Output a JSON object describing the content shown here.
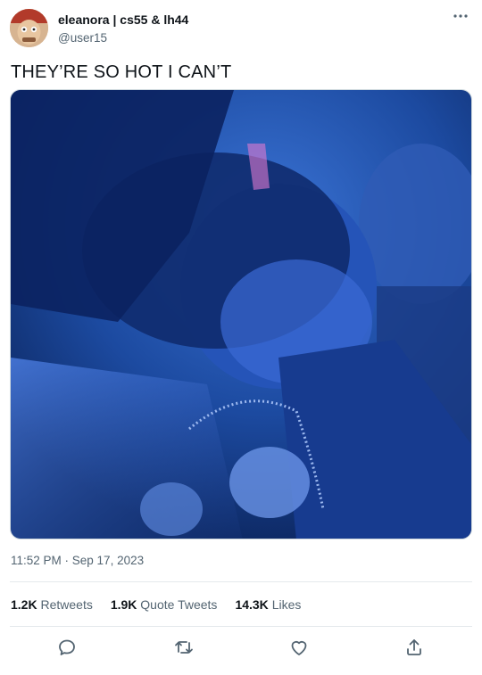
{
  "author": {
    "display_name": "eleanora | cs55 & lh44",
    "handle": "@user15"
  },
  "tweet": {
    "text": "THEY’RE SO HOT I CAN’T",
    "timestamp": "11:52 PM · Sep 17, 2023"
  },
  "stats": {
    "retweets_count": "1.2K",
    "retweets_label": "Retweets",
    "quote_count": "1.9K",
    "quote_label": "Quote Tweets",
    "likes_count": "14.3K",
    "likes_label": "Likes"
  },
  "icons": {
    "more": "more-icon",
    "reply": "reply-icon",
    "retweet": "retweet-icon",
    "like": "like-icon",
    "share": "share-icon"
  },
  "colors": {
    "text_primary": "#0f1419",
    "text_secondary": "#536471",
    "divider": "#e4e9ec"
  }
}
